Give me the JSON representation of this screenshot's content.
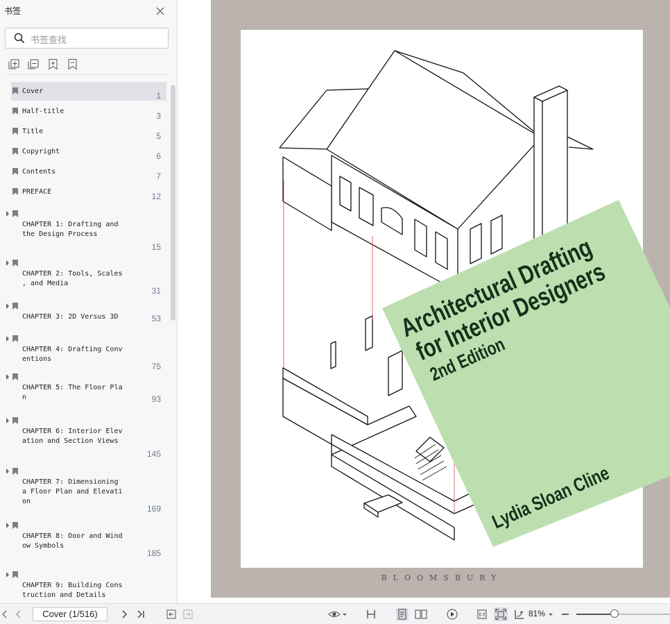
{
  "sidebar": {
    "title": "书签",
    "search_placeholder": "书签查找",
    "bookmarks": [
      {
        "label": "Cover",
        "page": "1"
      },
      {
        "label": "Half-title",
        "page": "3"
      },
      {
        "label": "Title",
        "page": "5"
      },
      {
        "label": "Copyright",
        "page": "6"
      },
      {
        "label": "Contents",
        "page": "7"
      },
      {
        "label": "PREFACE",
        "page": "12"
      },
      {
        "label": "CHAPTER 1: Drafting and\nthe Design Process",
        "page": "15"
      },
      {
        "label": "CHAPTER 2: Tools, Scales\n, and Media",
        "page": "31"
      },
      {
        "label": "CHAPTER 3: 2D Versus 3D",
        "page": "53"
      },
      {
        "label": "CHAPTER 4: Drafting Conv\nentions",
        "page": "75"
      },
      {
        "label": "CHAPTER 5: The Floor Pla\nn",
        "page": "93"
      },
      {
        "label": "CHAPTER 6: Interior Elev\nation and Section Views",
        "page": "145"
      },
      {
        "label": "CHAPTER 7: Dimensioning\na Floor Plan and Elevati\non",
        "page": "169"
      },
      {
        "label": "CHAPTER 8: Door and Wind\now Symbols",
        "page": "185"
      },
      {
        "label": "CHAPTER 9: Building Cons\ntruction and Details",
        "page": ""
      }
    ]
  },
  "cover": {
    "title_line1": "Architectural Drafting",
    "title_line2": "for Interior Designers",
    "edition": "2nd Edition",
    "author": "Lydia Sloan Cline",
    "publisher": "BLOOMSBURY",
    "box_color": "#bddfb0",
    "text_color": "#12331a"
  },
  "statusbar": {
    "page_indicator": "Cover (1/516)",
    "zoom": "81%",
    "zoom_level_fraction": 0.81
  },
  "colors": {
    "page_background": "#bcb2ae",
    "sidebar_background": "#f7f7f8",
    "selected_bookmark": "#dfe1e7"
  }
}
